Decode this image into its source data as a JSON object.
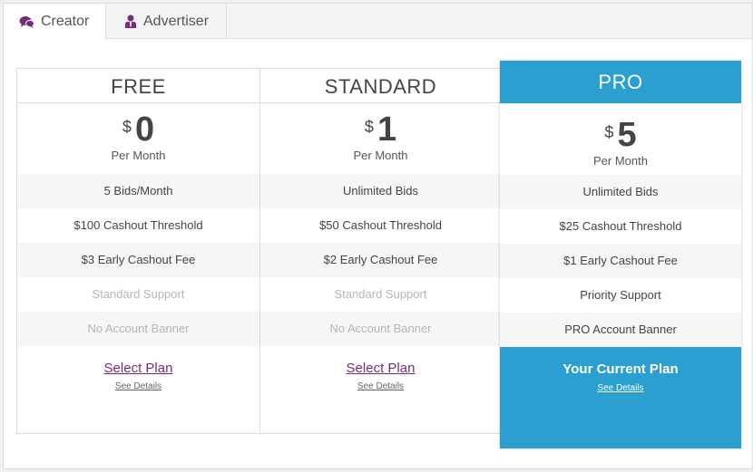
{
  "tabs": [
    {
      "label": "Creator",
      "icon": "chat-bubbles-icon",
      "active": true
    },
    {
      "label": "Advertiser",
      "icon": "user-tie-icon",
      "active": false
    }
  ],
  "colors": {
    "accent": "#2a9fd0",
    "link": "#7b2a78",
    "muted": "#b5b5b5"
  },
  "plans": [
    {
      "name": "FREE",
      "currency": "$",
      "amount": "0",
      "period": "Per Month",
      "features": [
        "5 Bids/Month",
        "$100 Cashout Threshold",
        "$3 Early Cashout Fee",
        "Standard Support",
        "No Account Banner"
      ],
      "action": "Select Plan",
      "details": "See Details"
    },
    {
      "name": "STANDARD",
      "currency": "$",
      "amount": "1",
      "period": "Per Month",
      "features": [
        "Unlimited Bids",
        "$50 Cashout Threshold",
        "$2 Early Cashout Fee",
        "Standard Support",
        "No Account Banner"
      ],
      "action": "Select Plan",
      "details": "See Details"
    },
    {
      "name": "PRO",
      "currency": "$",
      "amount": "5",
      "period": "Per Month",
      "features": [
        "Unlimited Bids",
        "$25 Cashout Threshold",
        "$1 Early Cashout Fee",
        "Priority Support",
        "PRO Account Banner"
      ],
      "action": "Your Current Plan",
      "details": "See Details"
    }
  ]
}
